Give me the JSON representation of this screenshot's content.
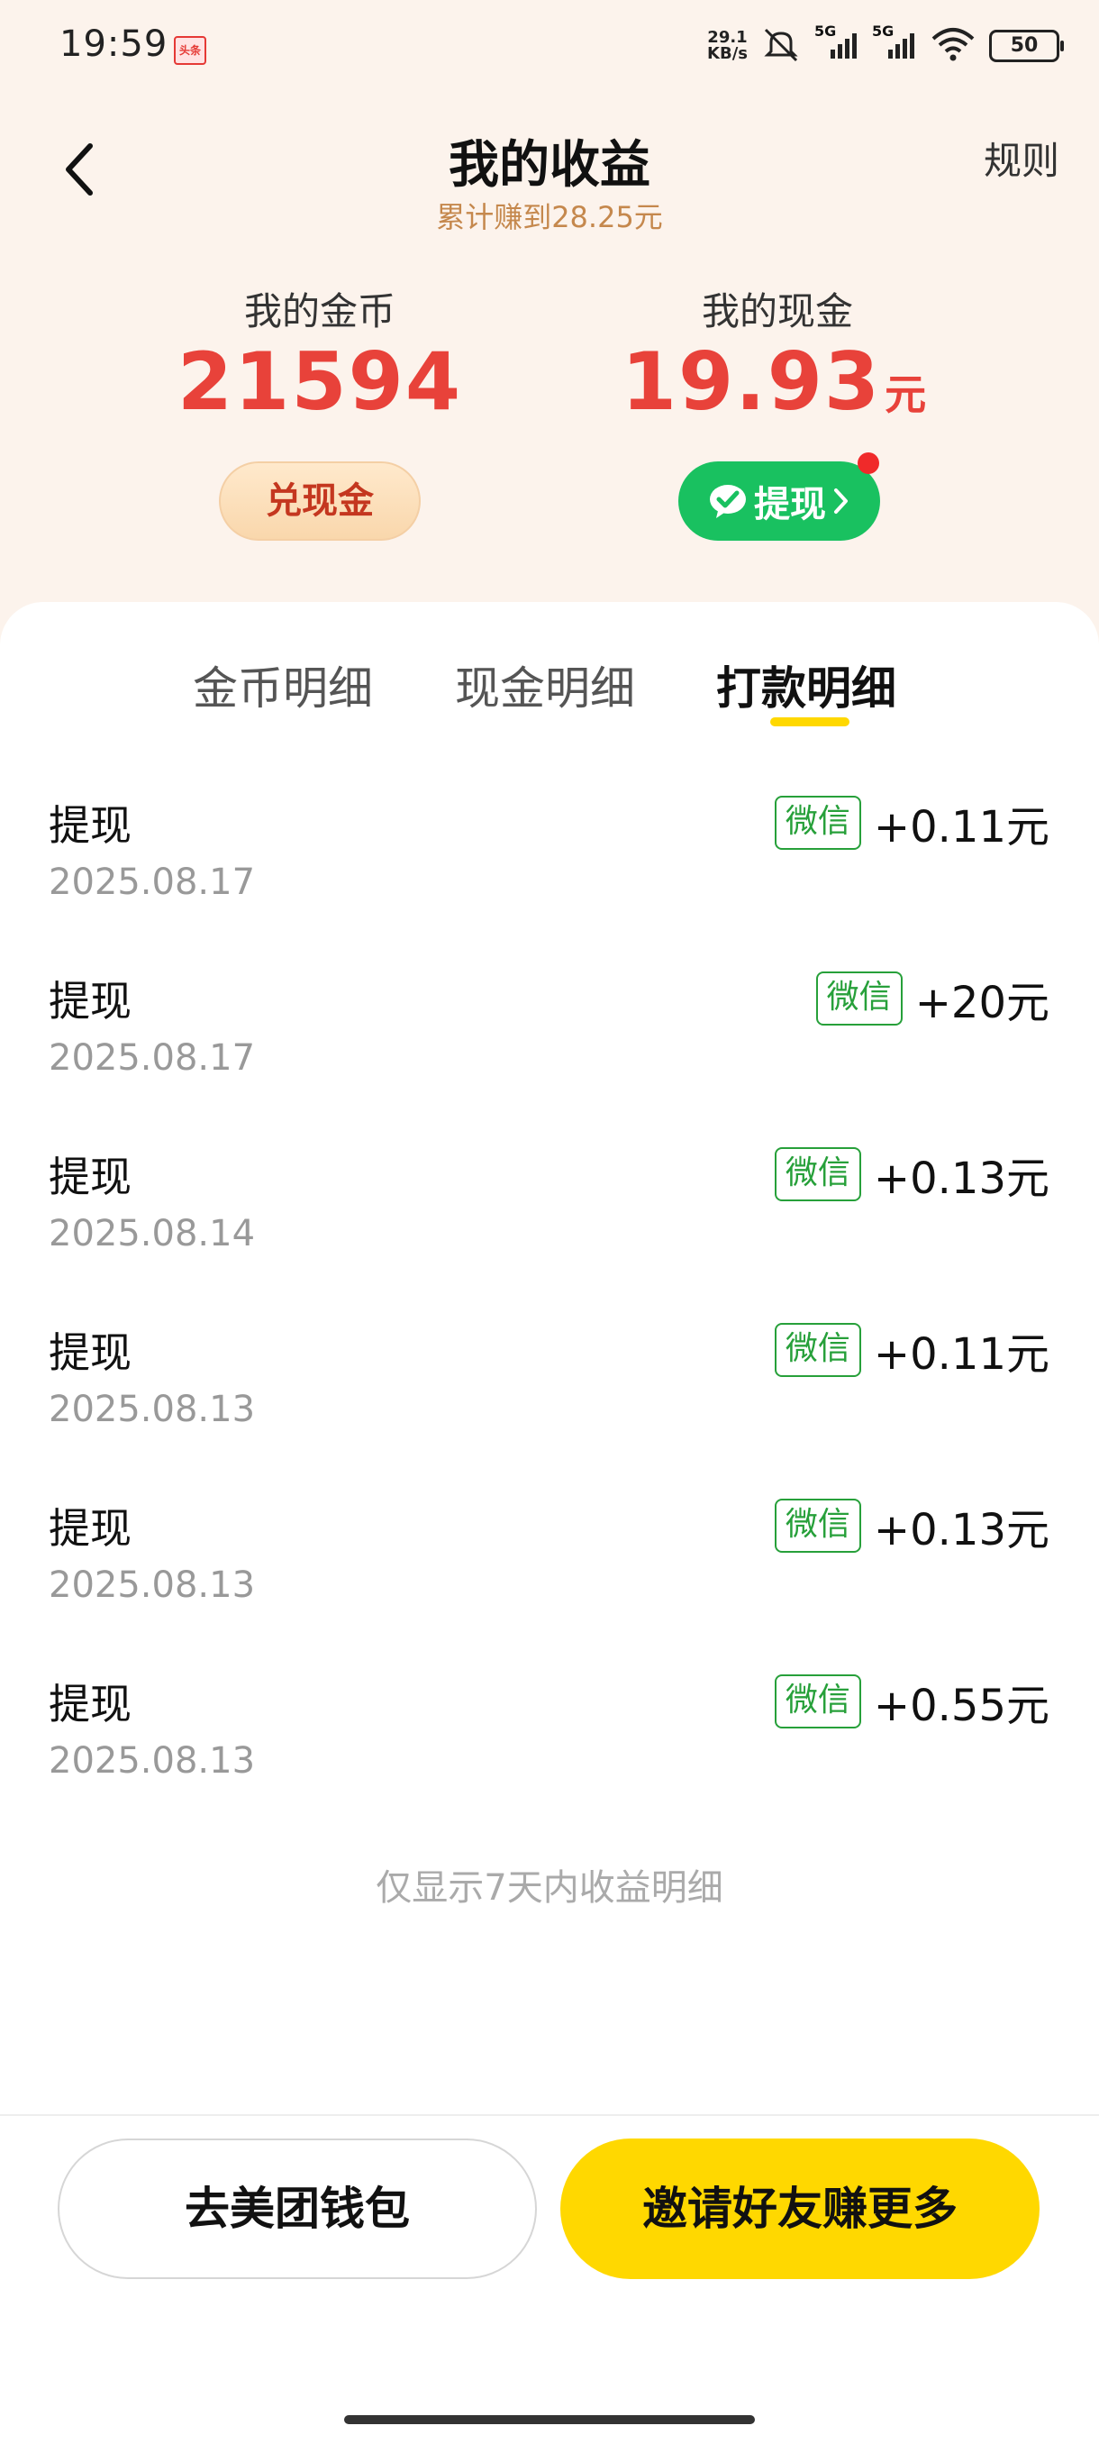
{
  "status_bar": {
    "time": "19:59",
    "app_icon_label": "头条",
    "net_speed_value": "29.1",
    "net_speed_unit": "KB/s",
    "signal1_label": "5G",
    "signal2_label": "5G",
    "battery": "50",
    "icons": [
      "mute-icon",
      "signal-icon",
      "wifi-icon",
      "battery-icon"
    ]
  },
  "header": {
    "title": "我的收益",
    "subtitle": "累计赚到28.25元",
    "rules_label": "规则"
  },
  "balances": {
    "coins_label": "我的金币",
    "coins_value": "21594",
    "cash_label": "我的现金",
    "cash_value": "19.93",
    "cash_unit": "元",
    "exchange_button": "兑现金",
    "withdraw_button": "提现"
  },
  "tabs": [
    {
      "label": "金币明细",
      "active": false
    },
    {
      "label": "现金明细",
      "active": false
    },
    {
      "label": "打款明细",
      "active": true
    }
  ],
  "records": [
    {
      "title": "提现",
      "date": "2025.08.17",
      "channel": "微信",
      "amount": "+0.11元"
    },
    {
      "title": "提现",
      "date": "2025.08.17",
      "channel": "微信",
      "amount": "+20元"
    },
    {
      "title": "提现",
      "date": "2025.08.14",
      "channel": "微信",
      "amount": "+0.13元"
    },
    {
      "title": "提现",
      "date": "2025.08.13",
      "channel": "微信",
      "amount": "+0.11元"
    },
    {
      "title": "提现",
      "date": "2025.08.13",
      "channel": "微信",
      "amount": "+0.13元"
    },
    {
      "title": "提现",
      "date": "2025.08.13",
      "channel": "微信",
      "amount": "+0.55元"
    }
  ],
  "footnote": "仅显示7天内收益明细",
  "bottom_buttons": {
    "wallet": "去美团钱包",
    "invite": "邀请好友赚更多"
  },
  "colors": {
    "accent_red": "#e8423a",
    "wechat_green": "#19c160",
    "badge_green": "#27a03a",
    "yellow": "#ffd800",
    "subtitle_brown": "#c5884d"
  }
}
